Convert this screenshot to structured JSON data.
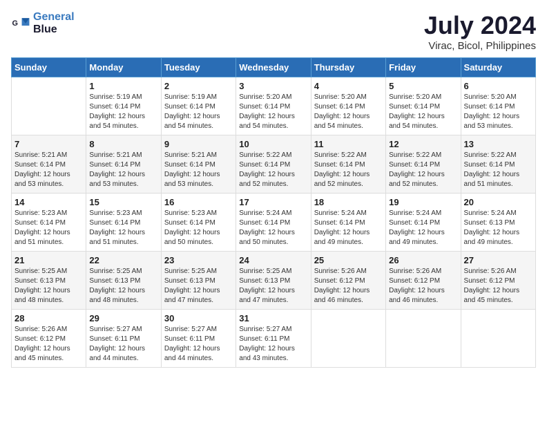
{
  "header": {
    "logo_line1": "General",
    "logo_line2": "Blue",
    "month_year": "July 2024",
    "location": "Virac, Bicol, Philippines"
  },
  "weekdays": [
    "Sunday",
    "Monday",
    "Tuesday",
    "Wednesday",
    "Thursday",
    "Friday",
    "Saturday"
  ],
  "weeks": [
    [
      {
        "day": "",
        "info": ""
      },
      {
        "day": "1",
        "info": "Sunrise: 5:19 AM\nSunset: 6:14 PM\nDaylight: 12 hours\nand 54 minutes."
      },
      {
        "day": "2",
        "info": "Sunrise: 5:19 AM\nSunset: 6:14 PM\nDaylight: 12 hours\nand 54 minutes."
      },
      {
        "day": "3",
        "info": "Sunrise: 5:20 AM\nSunset: 6:14 PM\nDaylight: 12 hours\nand 54 minutes."
      },
      {
        "day": "4",
        "info": "Sunrise: 5:20 AM\nSunset: 6:14 PM\nDaylight: 12 hours\nand 54 minutes."
      },
      {
        "day": "5",
        "info": "Sunrise: 5:20 AM\nSunset: 6:14 PM\nDaylight: 12 hours\nand 54 minutes."
      },
      {
        "day": "6",
        "info": "Sunrise: 5:20 AM\nSunset: 6:14 PM\nDaylight: 12 hours\nand 53 minutes."
      }
    ],
    [
      {
        "day": "7",
        "info": "Sunrise: 5:21 AM\nSunset: 6:14 PM\nDaylight: 12 hours\nand 53 minutes."
      },
      {
        "day": "8",
        "info": "Sunrise: 5:21 AM\nSunset: 6:14 PM\nDaylight: 12 hours\nand 53 minutes."
      },
      {
        "day": "9",
        "info": "Sunrise: 5:21 AM\nSunset: 6:14 PM\nDaylight: 12 hours\nand 53 minutes."
      },
      {
        "day": "10",
        "info": "Sunrise: 5:22 AM\nSunset: 6:14 PM\nDaylight: 12 hours\nand 52 minutes."
      },
      {
        "day": "11",
        "info": "Sunrise: 5:22 AM\nSunset: 6:14 PM\nDaylight: 12 hours\nand 52 minutes."
      },
      {
        "day": "12",
        "info": "Sunrise: 5:22 AM\nSunset: 6:14 PM\nDaylight: 12 hours\nand 52 minutes."
      },
      {
        "day": "13",
        "info": "Sunrise: 5:22 AM\nSunset: 6:14 PM\nDaylight: 12 hours\nand 51 minutes."
      }
    ],
    [
      {
        "day": "14",
        "info": "Sunrise: 5:23 AM\nSunset: 6:14 PM\nDaylight: 12 hours\nand 51 minutes."
      },
      {
        "day": "15",
        "info": "Sunrise: 5:23 AM\nSunset: 6:14 PM\nDaylight: 12 hours\nand 51 minutes."
      },
      {
        "day": "16",
        "info": "Sunrise: 5:23 AM\nSunset: 6:14 PM\nDaylight: 12 hours\nand 50 minutes."
      },
      {
        "day": "17",
        "info": "Sunrise: 5:24 AM\nSunset: 6:14 PM\nDaylight: 12 hours\nand 50 minutes."
      },
      {
        "day": "18",
        "info": "Sunrise: 5:24 AM\nSunset: 6:14 PM\nDaylight: 12 hours\nand 49 minutes."
      },
      {
        "day": "19",
        "info": "Sunrise: 5:24 AM\nSunset: 6:14 PM\nDaylight: 12 hours\nand 49 minutes."
      },
      {
        "day": "20",
        "info": "Sunrise: 5:24 AM\nSunset: 6:13 PM\nDaylight: 12 hours\nand 49 minutes."
      }
    ],
    [
      {
        "day": "21",
        "info": "Sunrise: 5:25 AM\nSunset: 6:13 PM\nDaylight: 12 hours\nand 48 minutes."
      },
      {
        "day": "22",
        "info": "Sunrise: 5:25 AM\nSunset: 6:13 PM\nDaylight: 12 hours\nand 48 minutes."
      },
      {
        "day": "23",
        "info": "Sunrise: 5:25 AM\nSunset: 6:13 PM\nDaylight: 12 hours\nand 47 minutes."
      },
      {
        "day": "24",
        "info": "Sunrise: 5:25 AM\nSunset: 6:13 PM\nDaylight: 12 hours\nand 47 minutes."
      },
      {
        "day": "25",
        "info": "Sunrise: 5:26 AM\nSunset: 6:12 PM\nDaylight: 12 hours\nand 46 minutes."
      },
      {
        "day": "26",
        "info": "Sunrise: 5:26 AM\nSunset: 6:12 PM\nDaylight: 12 hours\nand 46 minutes."
      },
      {
        "day": "27",
        "info": "Sunrise: 5:26 AM\nSunset: 6:12 PM\nDaylight: 12 hours\nand 45 minutes."
      }
    ],
    [
      {
        "day": "28",
        "info": "Sunrise: 5:26 AM\nSunset: 6:12 PM\nDaylight: 12 hours\nand 45 minutes."
      },
      {
        "day": "29",
        "info": "Sunrise: 5:27 AM\nSunset: 6:11 PM\nDaylight: 12 hours\nand 44 minutes."
      },
      {
        "day": "30",
        "info": "Sunrise: 5:27 AM\nSunset: 6:11 PM\nDaylight: 12 hours\nand 44 minutes."
      },
      {
        "day": "31",
        "info": "Sunrise: 5:27 AM\nSunset: 6:11 PM\nDaylight: 12 hours\nand 43 minutes."
      },
      {
        "day": "",
        "info": ""
      },
      {
        "day": "",
        "info": ""
      },
      {
        "day": "",
        "info": ""
      }
    ]
  ]
}
